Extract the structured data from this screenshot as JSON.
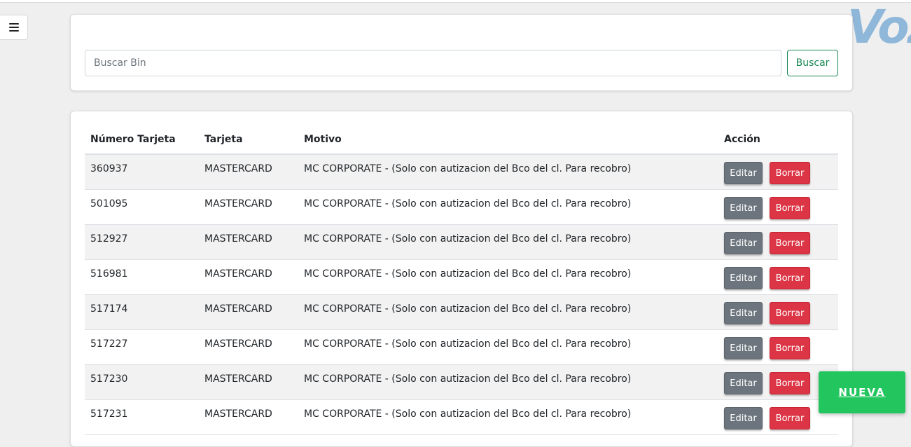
{
  "app": {
    "logo_text": "Voz"
  },
  "search": {
    "placeholder": "Buscar Bin",
    "value": "",
    "button_label": "Buscar"
  },
  "table": {
    "headers": [
      "Número Tarjeta",
      "Tarjeta",
      "Motivo",
      "Acción"
    ],
    "rows": [
      {
        "numero": "360937",
        "tarjeta": "MASTERCARD",
        "motivo": "MC CORPORATE - (Solo con autizacion del Bco del cl. Para recobro)"
      },
      {
        "numero": "501095",
        "tarjeta": "MASTERCARD",
        "motivo": "MC CORPORATE - (Solo con autizacion del Bco del cl. Para recobro)"
      },
      {
        "numero": "512927",
        "tarjeta": "MASTERCARD",
        "motivo": "MC CORPORATE - (Solo con autizacion del Bco del cl. Para recobro)"
      },
      {
        "numero": "516981",
        "tarjeta": "MASTERCARD",
        "motivo": "MC CORPORATE - (Solo con autizacion del Bco del cl. Para recobro)"
      },
      {
        "numero": "517174",
        "tarjeta": "MASTERCARD",
        "motivo": "MC CORPORATE - (Solo con autizacion del Bco del cl. Para recobro)"
      },
      {
        "numero": "517227",
        "tarjeta": "MASTERCARD",
        "motivo": "MC CORPORATE - (Solo con autizacion del Bco del cl. Para recobro)"
      },
      {
        "numero": "517230",
        "tarjeta": "MASTERCARD",
        "motivo": "MC CORPORATE - (Solo con autizacion del Bco del cl. Para recobro)"
      },
      {
        "numero": "517231",
        "tarjeta": "MASTERCARD",
        "motivo": "MC CORPORATE - (Solo con autizacion del Bco del cl. Para recobro)"
      }
    ],
    "edit_label": "Editar",
    "delete_label": "Borrar"
  },
  "fab": {
    "label": "NUEVA"
  },
  "colors": {
    "background": "#efefef",
    "edit_button": "#6c757d",
    "delete_button": "#dc3545",
    "search_button": "#198754",
    "fab": "#22c55e",
    "logo": "#8fb7d9"
  },
  "icons": {
    "menu": "hamburger-icon"
  }
}
